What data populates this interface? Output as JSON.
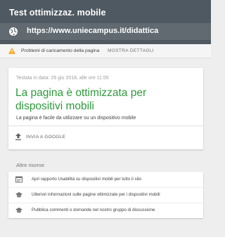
{
  "header": {
    "title": "Test ottimizzaz. mobile",
    "url": "https://www.uniecampus.it/didattica"
  },
  "warning": {
    "text": "Problemi di caricamento della pagina",
    "link": "MOSTRA DETTAGLI",
    "color": "#f9a825"
  },
  "result": {
    "tested": "Testata in data: 26 giu 2018, alle ore 11:55",
    "title": "La pagina è ottimizzata per dispositivi mobili",
    "subtitle": "La pagina è facile da utilizzare su un dispositivo mobile",
    "share_label": "INVIA A GOOGLE",
    "accent": "#2e9a3c"
  },
  "resources": {
    "heading": "Altre risorse",
    "items": [
      {
        "icon": "report-icon",
        "label": "Apri rapporto Usabilità su dispositivi mobili per tutto il sito"
      },
      {
        "icon": "school-icon",
        "label": "Ulteriori informazioni sulle pagine ottimizzate per i dispositivi mobili"
      },
      {
        "icon": "school-icon",
        "label": "Pubblica commenti o domande nel nostro gruppo di discussione"
      }
    ]
  }
}
